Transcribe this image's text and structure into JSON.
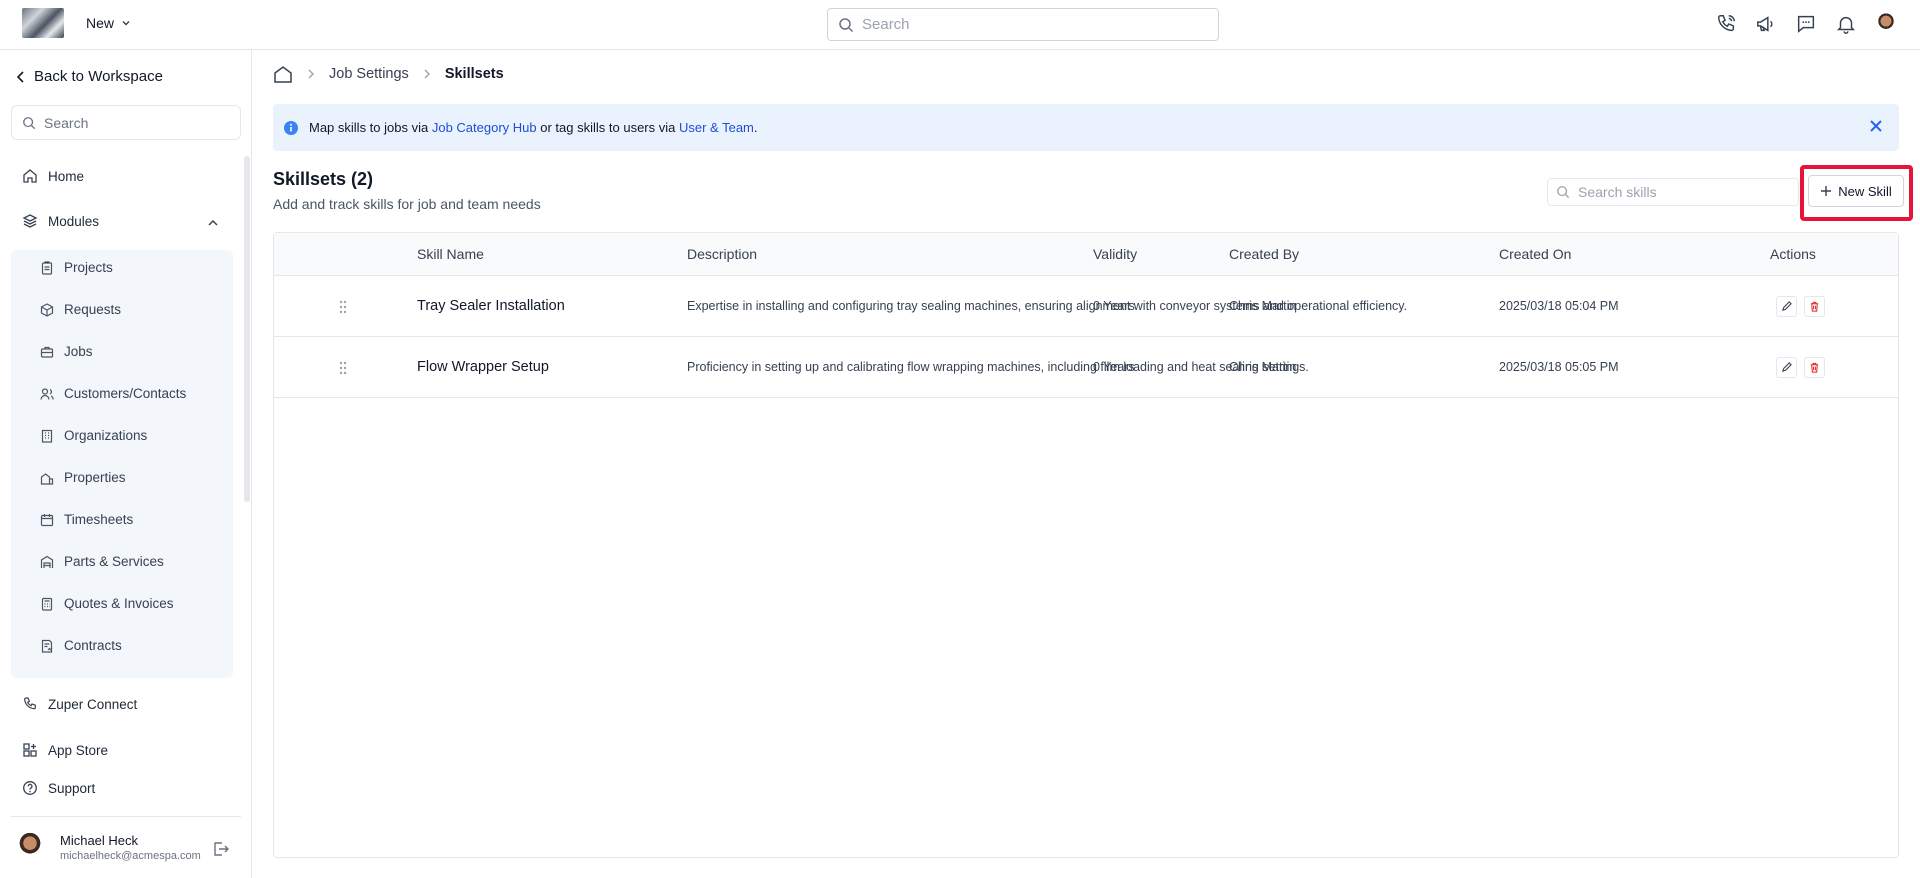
{
  "topbar": {
    "new_label": "New",
    "search_placeholder": "Search"
  },
  "sidebar": {
    "back_label": "Back to Workspace",
    "search_placeholder": "Search",
    "home": "Home",
    "modules": "Modules",
    "sub_items": [
      "Projects",
      "Requests",
      "Jobs",
      "Customers/Contacts",
      "Organizations",
      "Properties",
      "Timesheets",
      "Parts & Services",
      "Quotes & Invoices",
      "Contracts"
    ],
    "zuper_connect": "Zuper Connect",
    "app_store": "App Store",
    "support": "Support",
    "user": {
      "name": "Michael Heck",
      "email": "michaelheck@acmespa.com"
    }
  },
  "breadcrumb": {
    "level1": "Job Settings",
    "level2": "Skillsets"
  },
  "info": {
    "prefix": "Map skills to jobs via",
    "link1": "Job Category Hub",
    "middle": "or tag skills to users via",
    "link2": "User & Team",
    "suffix": ".",
    "accent": "#2563eb"
  },
  "page": {
    "title": "Skillsets (2)",
    "subtitle": "Add and track skills for job and team needs",
    "search_placeholder": "Search skills",
    "new_skill_label": "New Skill",
    "highlight_color": "#e8133a"
  },
  "table": {
    "headers": [
      "Skill Name",
      "Description",
      "Validity",
      "Created By",
      "Created On",
      "Actions"
    ],
    "rows": [
      {
        "name": "Tray Sealer Installation",
        "description": "Expertise in installing and configuring tray sealing machines, ensuring alignment with conveyor systems and operational efficiency.",
        "validity": "0 Years",
        "created_by": "Chris Martin",
        "created_on": "2025/03/18 05:04 PM"
      },
      {
        "name": "Flow Wrapper Setup",
        "description": "Proficiency in setting up and calibrating flow wrapping machines, including film loading and heat sealing settings.",
        "validity": "0 Years",
        "created_by": "Chris Martin",
        "created_on": "2025/03/18 05:05 PM"
      }
    ]
  }
}
